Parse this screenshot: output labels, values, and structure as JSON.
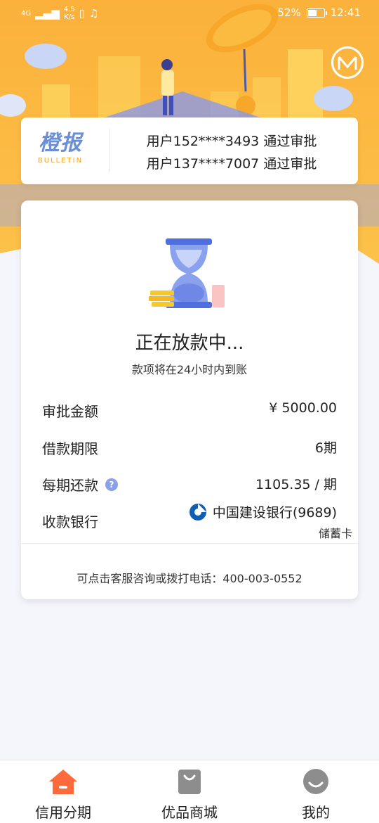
{
  "status_bar": {
    "network_label": "4G",
    "net_speed_value": "4.5",
    "net_speed_unit": "K/s",
    "battery_percent": "52%",
    "time": "12:41"
  },
  "bulletin": {
    "logo_cn": "橙报",
    "logo_en": "BULLETIN",
    "messages": [
      "用户152****3493 通过审批",
      "用户137****7007 通过审批"
    ]
  },
  "loan_status": {
    "title": "正在放款中...",
    "subtitle": "款项将在24小时内到账"
  },
  "details": {
    "approved_amount_label": "审批金额",
    "approved_amount_value": "¥ 5000.00",
    "term_label": "借款期限",
    "term_value": "6期",
    "installment_label": "每期还款",
    "installment_value": "1105.35 / 期",
    "bank_label": "收款银行",
    "bank_name": "中国建设银行(9689)",
    "card_type": "储蓄卡"
  },
  "contact_text": "可点击客服咨询或拨打电话：400-003-0552",
  "tabs": [
    {
      "label": "信用分期"
    },
    {
      "label": "优品商城"
    },
    {
      "label": "我的"
    }
  ],
  "colors": {
    "accent_orange": "#ff6a3d",
    "hero_orange": "#fbb03b",
    "bank_blue": "#0d5fb5",
    "hourglass_blue": "#5b7ee8"
  }
}
